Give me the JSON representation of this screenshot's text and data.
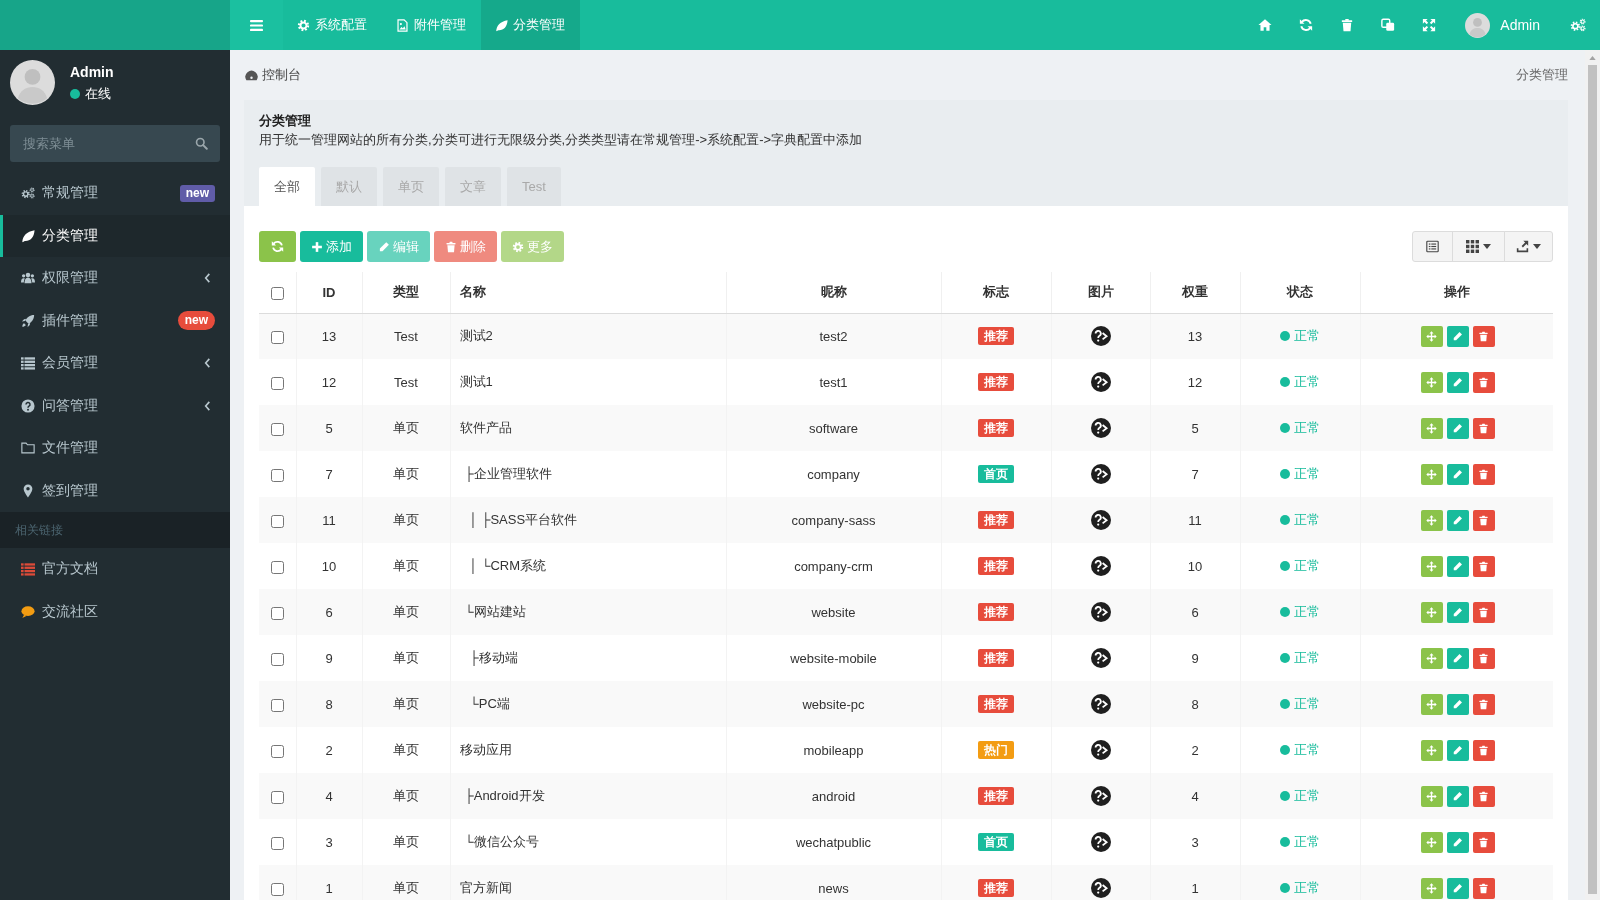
{
  "top_nav": {
    "items": [
      {
        "label": "系统配置",
        "selected": false
      },
      {
        "label": "附件管理",
        "selected": false
      },
      {
        "label": "分类管理",
        "selected": true
      }
    ],
    "user": "Admin"
  },
  "sidebar": {
    "user": {
      "name": "Admin",
      "status": "在线"
    },
    "search": {
      "placeholder": "搜索菜单"
    },
    "menu": [
      {
        "label": "常规管理",
        "selected": false,
        "submenu": false,
        "badge": {
          "text": "new",
          "kind": "label",
          "color": "#605ca8"
        }
      },
      {
        "label": "分类管理",
        "selected": true,
        "submenu": false
      },
      {
        "label": "权限管理",
        "selected": false,
        "submenu": true
      },
      {
        "label": "插件管理",
        "selected": false,
        "submenu": false,
        "badge": {
          "text": "new",
          "kind": "pill",
          "color": "#e74c3c"
        }
      },
      {
        "label": "会员管理",
        "selected": false,
        "submenu": true
      },
      {
        "label": "问答管理",
        "selected": false,
        "submenu": true
      },
      {
        "label": "文件管理",
        "selected": false,
        "submenu": false
      },
      {
        "label": "签到管理",
        "selected": false,
        "submenu": false
      }
    ],
    "section_header": "相关链接",
    "links": [
      {
        "label": "官方文档",
        "color": "#dd4b39"
      },
      {
        "label": "交流社区",
        "color": "#f39c12"
      }
    ]
  },
  "breadcrumb": {
    "home": "控制台",
    "current": "分类管理"
  },
  "panel": {
    "title": "分类管理",
    "description": "用于统一管理网站的所有分类,分类可进行无限级分类,分类类型请在常规管理->系统配置->字典配置中添加",
    "tabs": [
      {
        "label": "全部",
        "selected": true
      },
      {
        "label": "默认",
        "selected": false
      },
      {
        "label": "单页",
        "selected": false
      },
      {
        "label": "文章",
        "selected": false
      },
      {
        "label": "Test",
        "selected": false
      }
    ]
  },
  "toolbar": {
    "buttons": [
      {
        "kind": "refresh",
        "disabled": false
      },
      {
        "kind": "add",
        "label": "添加",
        "disabled": false
      },
      {
        "kind": "edit",
        "label": "编辑",
        "disabled": true
      },
      {
        "kind": "delete",
        "label": "删除",
        "disabled": true
      },
      {
        "kind": "more",
        "label": "更多",
        "disabled": true
      }
    ],
    "tools": [
      {
        "kind": "view",
        "dropdown": false
      },
      {
        "kind": "columns",
        "dropdown": true
      },
      {
        "kind": "export",
        "dropdown": true
      }
    ]
  },
  "table": {
    "select_all": {
      "checked": false
    },
    "columns": [
      "ID",
      "类型",
      "名称",
      "昵称",
      "标志",
      "图片",
      "权重",
      "状态",
      "操作"
    ],
    "rows": [
      {
        "id": "13",
        "type": "Test",
        "name": "测试2",
        "nickname": "test2",
        "flag": {
          "text": "推荐",
          "color": "#e74c3c"
        },
        "weight": "13",
        "status": "正常",
        "checked": false
      },
      {
        "id": "12",
        "type": "Test",
        "name": "测试1",
        "nickname": "test1",
        "flag": {
          "text": "推荐",
          "color": "#e74c3c"
        },
        "weight": "12",
        "status": "正常",
        "checked": false
      },
      {
        "id": "5",
        "type": "单页",
        "name": "软件产品",
        "nickname": "software",
        "flag": {
          "text": "推荐",
          "color": "#e74c3c"
        },
        "weight": "5",
        "status": "正常",
        "checked": false,
        "children": [
          {
            "id": "7",
            "type": "单页",
            "name": "├企业管理软件",
            "nickname": "company",
            "flag": {
              "text": "首页",
              "color": "#18bc9c"
            },
            "weight": "7",
            "status": "正常",
            "checked": false,
            "children": [
              {
                "id": "11",
                "type": "单页",
                "name": "│ ├SASS平台软件",
                "nickname": "company-sass",
                "flag": {
                  "text": "推荐",
                  "color": "#e74c3c"
                },
                "weight": "11",
                "status": "正常",
                "checked": false
              },
              {
                "id": "10",
                "type": "单页",
                "name": "│ └CRM系统",
                "nickname": "company-crm",
                "flag": {
                  "text": "推荐",
                  "color": "#e74c3c"
                },
                "weight": "10",
                "status": "正常",
                "checked": false
              }
            ]
          },
          {
            "id": "6",
            "type": "单页",
            "name": "└网站建站",
            "nickname": "website",
            "flag": {
              "text": "推荐",
              "color": "#e74c3c"
            },
            "weight": "6",
            "status": "正常",
            "checked": false,
            "children": [
              {
                "id": "9",
                "type": "单页",
                "name": "├移动端",
                "nickname": "website-mobile",
                "flag": {
                  "text": "推荐",
                  "color": "#e74c3c"
                },
                "weight": "9",
                "status": "正常",
                "checked": false
              },
              {
                "id": "8",
                "type": "单页",
                "name": "└PC端",
                "nickname": "website-pc",
                "flag": {
                  "text": "推荐",
                  "color": "#e74c3c"
                },
                "weight": "8",
                "status": "正常",
                "checked": false
              }
            ]
          }
        ]
      },
      {
        "id": "2",
        "type": "单页",
        "name": "移动应用",
        "nickname": "mobileapp",
        "flag": {
          "text": "热门",
          "color": "#f39c12"
        },
        "weight": "2",
        "status": "正常",
        "checked": false,
        "children": [
          {
            "id": "4",
            "type": "单页",
            "name": "├Android开发",
            "nickname": "android",
            "flag": {
              "text": "推荐",
              "color": "#e74c3c"
            },
            "weight": "4",
            "status": "正常",
            "checked": false
          },
          {
            "id": "3",
            "type": "单页",
            "name": "└微信公众号",
            "nickname": "wechatpublic",
            "flag": {
              "text": "首页",
              "color": "#18bc9c"
            },
            "weight": "3",
            "status": "正常",
            "checked": false
          }
        ]
      },
      {
        "id": "1",
        "type": "单页",
        "name": "官方新闻",
        "nickname": "news",
        "flag": {
          "text": "推荐",
          "color": "#e74c3c"
        },
        "weight": "1",
        "status": "正常",
        "checked": false
      }
    ]
  }
}
